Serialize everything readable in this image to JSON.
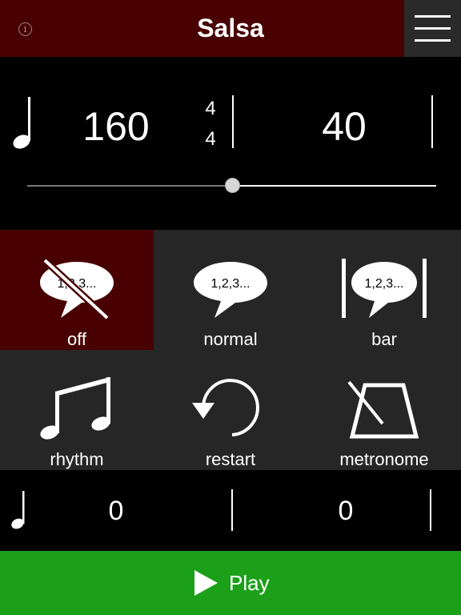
{
  "header": {
    "title": "Salsa",
    "info_icon": "info-icon",
    "menu_icon": "hamburger-menu-icon"
  },
  "tempo": {
    "bpm": "160",
    "time_signature_top": "4",
    "time_signature_bottom": "4",
    "value_right": "40",
    "slider_fraction": 0.5
  },
  "modes": [
    {
      "label": "off",
      "icon": "count-off-icon",
      "active": true
    },
    {
      "label": "normal",
      "icon": "count-normal-icon",
      "active": false
    },
    {
      "label": "bar",
      "icon": "count-bar-icon",
      "active": false
    },
    {
      "label": "rhythm",
      "icon": "music-notes-icon",
      "active": false
    },
    {
      "label": "restart",
      "icon": "restart-icon",
      "active": false
    },
    {
      "label": "metronome",
      "icon": "metronome-icon",
      "active": false
    }
  ],
  "bubble_text": "1,2,3...",
  "counters": {
    "left": "0",
    "right": "0"
  },
  "play": {
    "label": "Play"
  },
  "colors": {
    "accent": "#480000",
    "panel": "#262626",
    "play": "#1ca01a"
  }
}
